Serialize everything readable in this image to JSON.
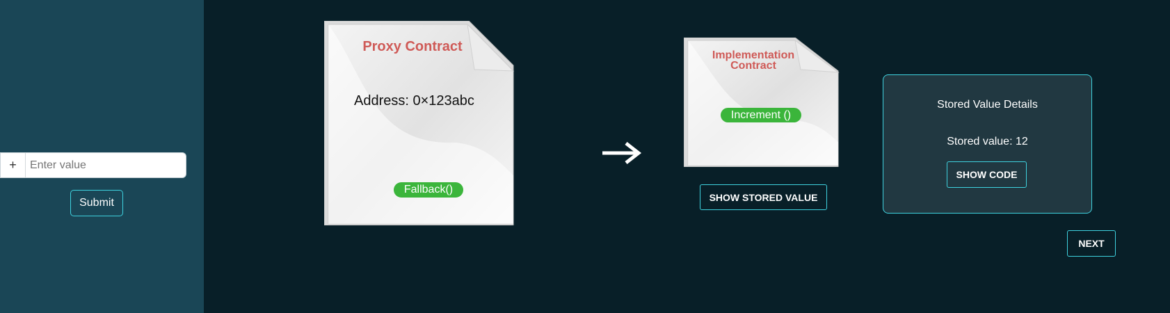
{
  "sidebar": {
    "input_prefix": "+",
    "input_placeholder": "Enter value",
    "input_value": "",
    "submit_label": "Submit"
  },
  "proxy_contract": {
    "title": "Proxy Contract",
    "address": "Address: 0×123abc",
    "fallback_label": "Fallback()"
  },
  "implementation_contract": {
    "title_line1": "Implementation",
    "title_line2": "Contract",
    "increment_label": "Increment ()"
  },
  "arrow_icon": "right-arrow",
  "show_stored_value_label": "SHOW STORED VALUE",
  "details": {
    "title": "Stored Value Details",
    "stored_value": "Stored value: 12",
    "show_code_label": "SHOW CODE"
  },
  "next_label": "NEXT",
  "colors": {
    "background": "#081f28",
    "sidebar": "#1a4656",
    "accent_border": "#3fd3e0",
    "title_red": "#cf5a57",
    "pill_green": "#3bb53b",
    "card": "#213841"
  }
}
